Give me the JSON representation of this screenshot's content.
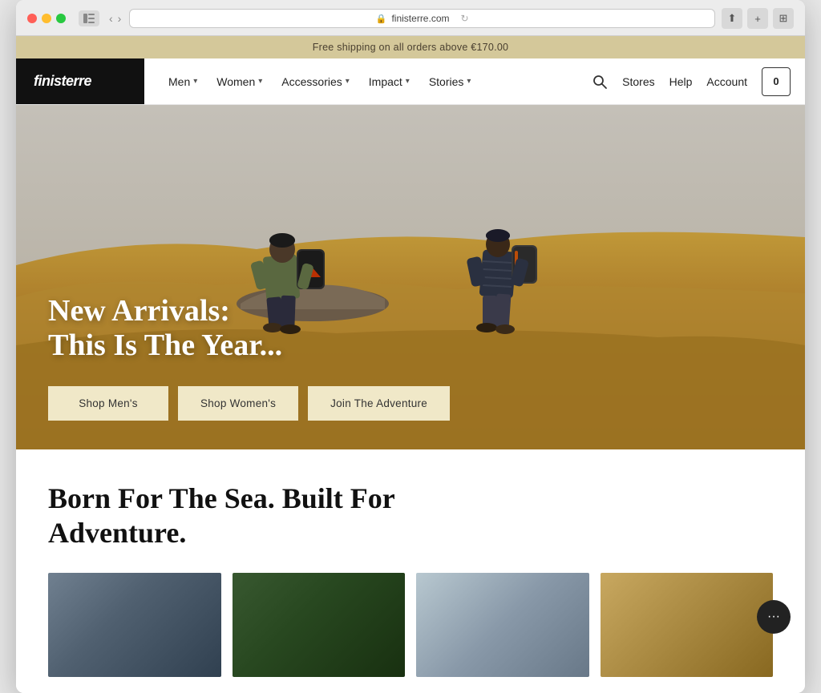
{
  "browser": {
    "url": "finisterre.com",
    "reload_icon": "↻",
    "back_icon": "‹",
    "forward_icon": "›"
  },
  "announcement": {
    "text": "Free shipping on all orders above €170.00"
  },
  "nav": {
    "logo": "finisterre",
    "links": [
      {
        "label": "Men",
        "has_dropdown": true
      },
      {
        "label": "Women",
        "has_dropdown": true
      },
      {
        "label": "Accessories",
        "has_dropdown": true
      },
      {
        "label": "Impact",
        "has_dropdown": true
      },
      {
        "label": "Stories",
        "has_dropdown": true
      }
    ],
    "stores": "Stores",
    "help": "Help",
    "account": "Account",
    "cart_count": "0"
  },
  "hero": {
    "headline_line1": "New Arrivals:",
    "headline_line2": "This Is The Year...",
    "btn_mens": "Shop Men's",
    "btn_womens": "Shop Women's",
    "btn_adventure": "Join The Adventure"
  },
  "below_hero": {
    "headline_line1": "Born For The Sea. Built For",
    "headline_line2": "Adventure."
  },
  "chat": {
    "icon": "···"
  }
}
